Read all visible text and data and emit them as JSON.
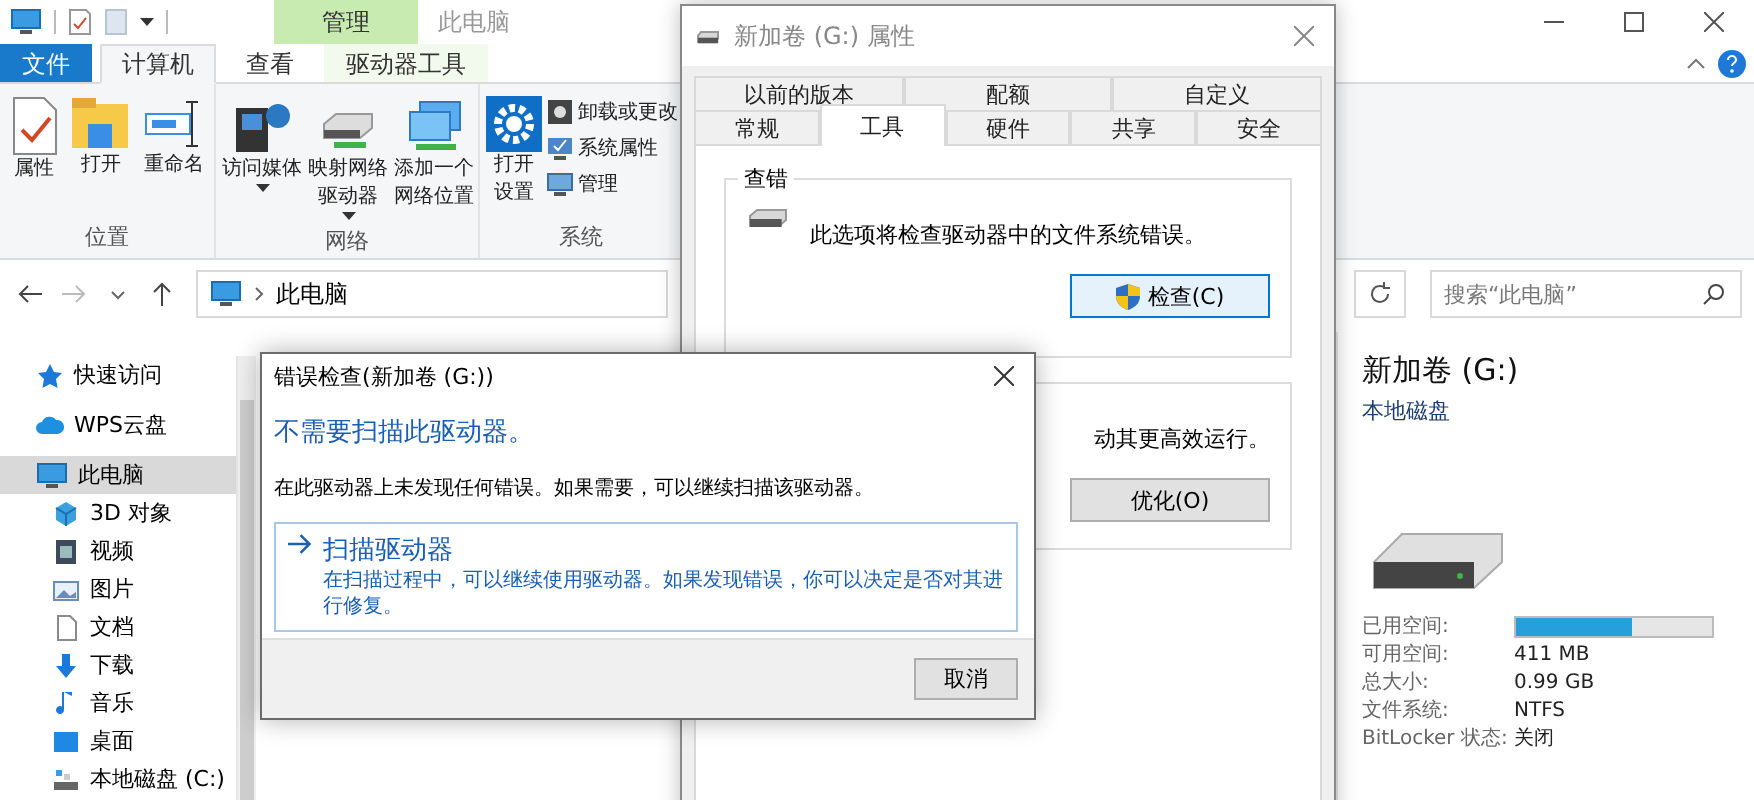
{
  "explorer": {
    "title": "此电脑",
    "context_tab": "管理",
    "tabs": [
      {
        "label": "文件",
        "kind": "file",
        "selected": false
      },
      {
        "label": "计算机",
        "kind": "tab",
        "selected": true
      },
      {
        "label": "查看",
        "kind": "tab",
        "selected": false
      },
      {
        "label": "驱动器工具",
        "kind": "context",
        "selected": false
      }
    ],
    "ribbon": [
      {
        "label": "位置",
        "commands": [
          {
            "kind": "large",
            "lines": [
              "属性"
            ],
            "dropdown": false
          },
          {
            "kind": "large",
            "lines": [
              "打开"
            ],
            "dropdown": false
          },
          {
            "kind": "large",
            "lines": [
              "重命名"
            ],
            "dropdown": false
          }
        ]
      },
      {
        "label": "网络",
        "commands": [
          {
            "kind": "large",
            "lines": [
              "访问媒体"
            ],
            "dropdown": true
          },
          {
            "kind": "large",
            "lines": [
              "映射网络",
              "驱动器"
            ],
            "dropdown": true
          },
          {
            "kind": "large",
            "lines": [
              "添加一个",
              "网络位置"
            ],
            "dropdown": false
          }
        ]
      },
      {
        "label": "系统",
        "commands": [
          {
            "kind": "large",
            "lines": [
              "打开",
              "设置"
            ],
            "dropdown": false
          },
          {
            "kind": "small",
            "lines": [
              "卸载或更改"
            ],
            "dropdown": false
          },
          {
            "kind": "small",
            "lines": [
              "系统属性"
            ],
            "dropdown": false
          },
          {
            "kind": "small",
            "lines": [
              "管理"
            ],
            "dropdown": false
          }
        ]
      }
    ],
    "address": {
      "path": "此电脑"
    },
    "search": {
      "placeholder": "搜索“此电脑”"
    },
    "nav": [
      {
        "label": "快速访问",
        "selected": false
      },
      {
        "label": "WPS云盘",
        "selected": false
      },
      {
        "label": "此电脑",
        "selected": true,
        "children": [
          {
            "label": "3D 对象",
            "selected": false
          },
          {
            "label": "视频",
            "selected": false
          },
          {
            "label": "图片",
            "selected": false
          },
          {
            "label": "文档",
            "selected": false
          },
          {
            "label": "下载",
            "selected": false
          },
          {
            "label": "音乐",
            "selected": false
          },
          {
            "label": "桌面",
            "selected": false
          },
          {
            "label": "本地磁盘 (C:)",
            "selected": false
          }
        ]
      }
    ],
    "details": {
      "name": "新加卷 (G:)",
      "type": "本地磁盘",
      "properties": [
        {
          "kind": "bar",
          "label": "已用空间:",
          "level": 0.59
        },
        {
          "kind": "text",
          "label": "可用空间:",
          "value": "411 MB"
        },
        {
          "kind": "text",
          "label": "总大小:",
          "value": "0.99 GB"
        },
        {
          "kind": "text",
          "label": "文件系统:",
          "value": "NTFS"
        },
        {
          "kind": "text",
          "label": "BitLocker 状态:",
          "value": "关闭"
        }
      ]
    }
  },
  "properties_window": {
    "title": "新加卷 (G:) 属性",
    "tab_rows": [
      {
        "tabs": [
          {
            "label": "以前的版本",
            "selected": false
          },
          {
            "label": "配额",
            "selected": false
          },
          {
            "label": "自定义",
            "selected": false
          }
        ]
      },
      {
        "tabs": [
          {
            "label": "常规",
            "selected": false
          },
          {
            "label": "工具",
            "selected": true
          },
          {
            "label": "硬件",
            "selected": false
          },
          {
            "label": "共享",
            "selected": false
          },
          {
            "label": "安全",
            "selected": false
          }
        ]
      }
    ],
    "groups": [
      {
        "title": "查错",
        "text": "此选项将检查驱动器中的文件系统错误。",
        "button": "检查(C)",
        "shield": true,
        "focused": true
      },
      {
        "text": "动其更高效运行。",
        "button": "优化(O)",
        "shield": false,
        "focused": false
      }
    ]
  },
  "error_dialog": {
    "title": "错误检查(新加卷 (G:))",
    "heading": "不需要扫描此驱动器。",
    "message": "在此驱动器上未发现任何错误。如果需要，可以继续扫描该驱动器。",
    "command": {
      "label": "扫描驱动器",
      "description": "在扫描过程中，可以继续使用驱动器。如果发现错误，你可以决定是否对其进行修复。"
    },
    "buttons": [
      "取消"
    ]
  }
}
